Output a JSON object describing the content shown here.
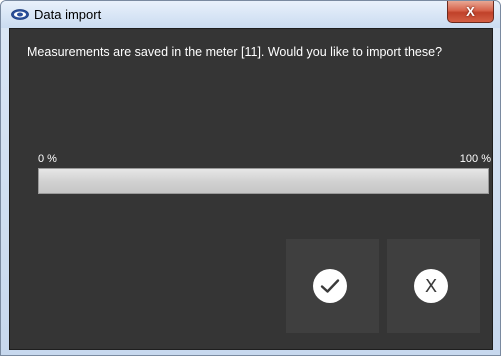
{
  "window": {
    "title": "Data import",
    "app_icon": "pce-logo-icon",
    "close_glyph": "X"
  },
  "dialog": {
    "message": "Measurements are saved in the meter [11]. Would you like to import these?",
    "progress": {
      "start_label": "0 %",
      "end_label": "100 %",
      "value_fraction": 0
    },
    "confirm_icon": "check-icon",
    "cancel_label": "X"
  },
  "colors": {
    "panel_bg": "#353535",
    "button_bg": "#3f3f3f",
    "text": "#ffffff",
    "titlebar": "#d6e4f5",
    "close_button": "#c0412a"
  }
}
